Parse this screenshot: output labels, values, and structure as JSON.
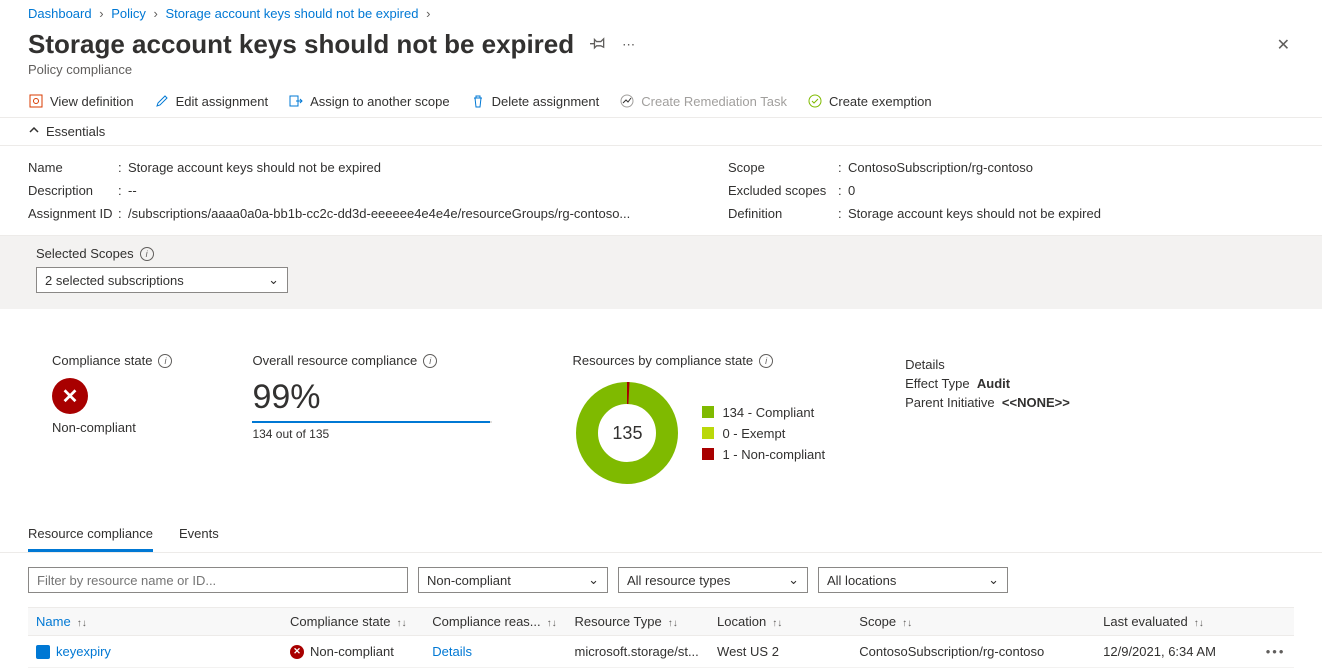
{
  "breadcrumbs": [
    "Dashboard",
    "Policy",
    "Storage account keys should not be expired"
  ],
  "title": "Storage account keys should not be expired",
  "subtitle": "Policy compliance",
  "toolbar": {
    "view_def": "View definition",
    "edit_assign": "Edit assignment",
    "assign_scope": "Assign to another scope",
    "delete_assign": "Delete assignment",
    "remediation": "Create Remediation Task",
    "exemption": "Create exemption"
  },
  "essentials": {
    "header": "Essentials",
    "name_k": "Name",
    "name_v": "Storage account keys should not be expired",
    "desc_k": "Description",
    "desc_v": "--",
    "aid_k": "Assignment ID",
    "aid_v": "/subscriptions/aaaa0a0a-bb1b-cc2c-dd3d-eeeeee4e4e4e/resourceGroups/rg-contoso...",
    "scope_k": "Scope",
    "scope_v": "ContosoSubscription/rg-contoso",
    "excl_k": "Excluded scopes",
    "excl_v": "0",
    "def_k": "Definition",
    "def_v": "Storage account keys should not be expired"
  },
  "scopes": {
    "label": "Selected Scopes",
    "selected": "2 selected subscriptions"
  },
  "compliance": {
    "state_label": "Compliance state",
    "state_value": "Non-compliant",
    "overall_label": "Overall resource compliance",
    "overall_pct": "99%",
    "overall_note": "134 out of 135",
    "by_state_label": "Resources by compliance state",
    "donut_total": "135",
    "legend": {
      "compliant": "134 - Compliant",
      "exempt": "0 - Exempt",
      "noncompliant": "1 - Non-compliant"
    },
    "details_label": "Details",
    "effect_k": "Effect Type",
    "effect_v": "Audit",
    "parent_k": "Parent Initiative",
    "parent_v": "<<NONE>>"
  },
  "tabs": {
    "rc": "Resource compliance",
    "events": "Events"
  },
  "filters": {
    "name_ph": "Filter by resource name or ID...",
    "compliance": "Non-compliant",
    "types": "All resource types",
    "locations": "All locations"
  },
  "columns": {
    "name": "Name",
    "cstate": "Compliance state",
    "creason": "Compliance reas...",
    "rtype": "Resource Type",
    "location": "Location",
    "scope": "Scope",
    "last": "Last evaluated"
  },
  "rows": [
    {
      "name": "keyexpiry",
      "cstate": "Non-compliant",
      "creason": "Details",
      "rtype": "microsoft.storage/st...",
      "location": "West US 2",
      "scope": "ContosoSubscription/rg-contoso",
      "last": "12/9/2021, 6:34 AM"
    }
  ]
}
